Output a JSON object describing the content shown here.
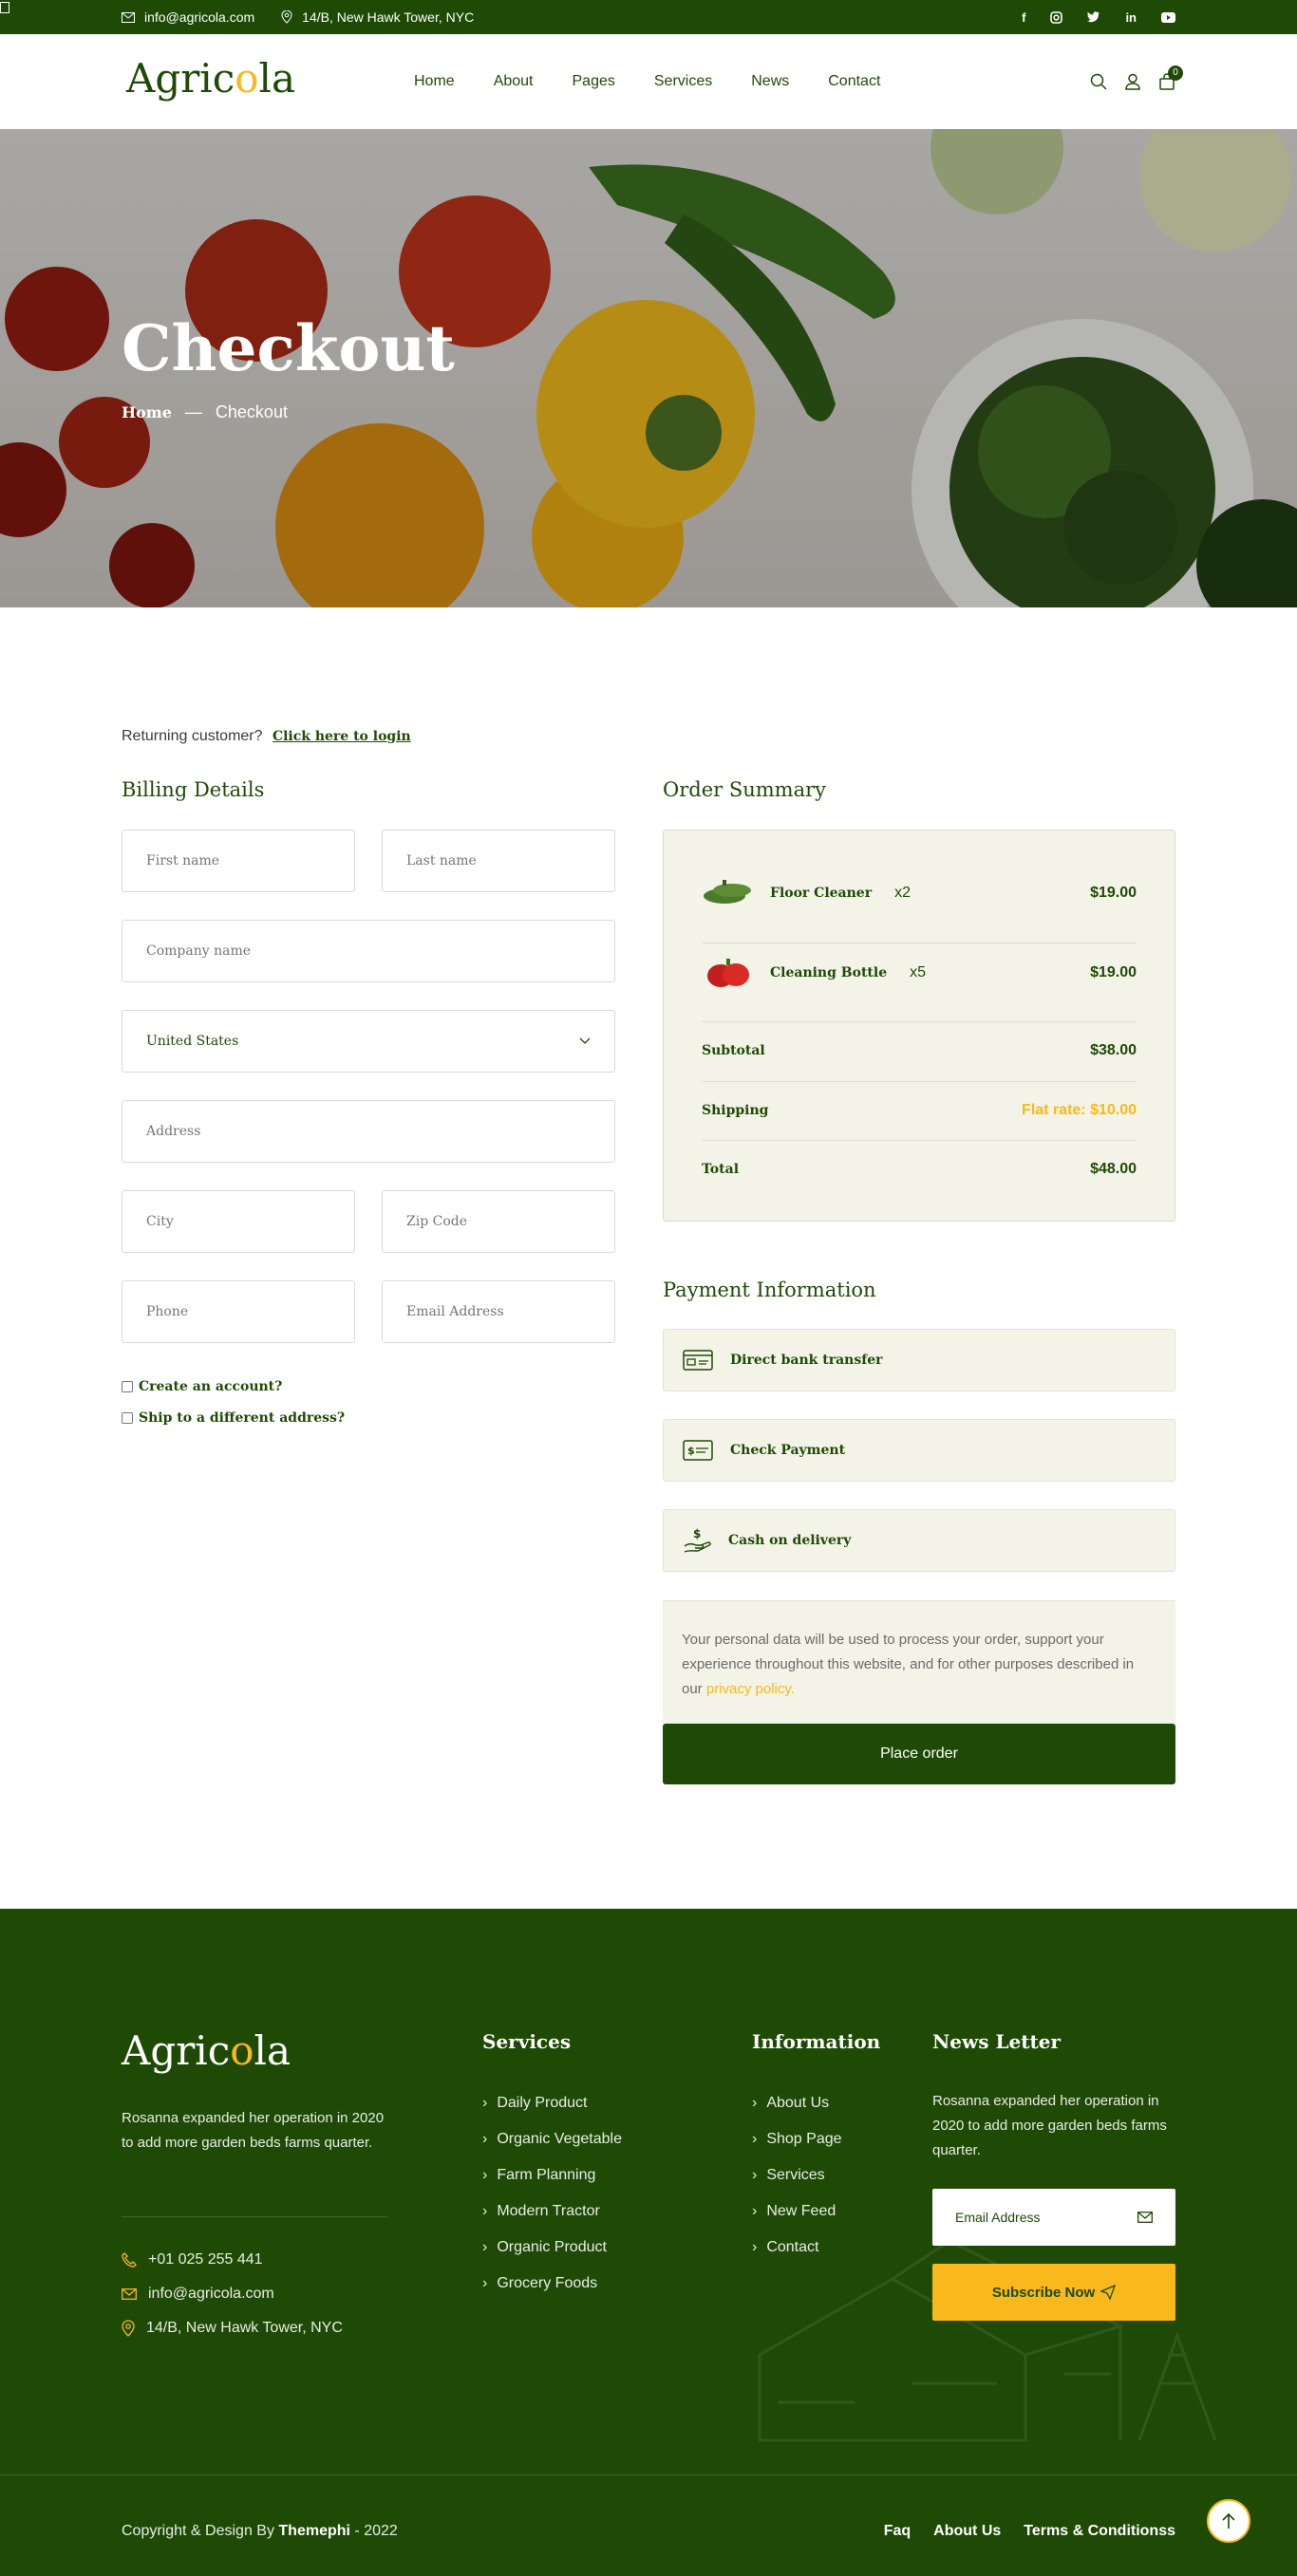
{
  "topbar": {
    "email": "info@agricola.com",
    "address": "14/B, New Hawk Tower, NYC",
    "social": [
      "f",
      "ig",
      "tw",
      "in",
      "yt"
    ]
  },
  "header": {
    "logo_pre": "Agric",
    "logo_o": "o",
    "logo_post": "la",
    "nav": [
      "Home",
      "About",
      "Pages",
      "Services",
      "News",
      "Contact"
    ],
    "cart_count": "0"
  },
  "hero": {
    "title": "Checkout",
    "breadcrumb_home": "Home",
    "breadcrumb_sep": "—",
    "breadcrumb_current": "Checkout"
  },
  "checkout": {
    "returning_text": "Returning customer?",
    "login_link": "Click here to login",
    "billing_title": "Billing Details",
    "placeholders": {
      "first_name": "First name",
      "last_name": "Last name",
      "company": "Company name",
      "address": "Address",
      "city": "City",
      "zip": "Zip Code",
      "phone": "Phone",
      "email": "Email Address"
    },
    "country": "United States",
    "create_account": "Create an account?",
    "ship_different": "Ship to a different address?"
  },
  "summary": {
    "title": "Order Summary",
    "items": [
      {
        "name": "Floor Cleaner",
        "qty": "x2",
        "price": "$19.00"
      },
      {
        "name": "Cleaning Bottle",
        "qty": "x5",
        "price": "$19.00"
      }
    ],
    "subtotal_label": "Subtotal",
    "subtotal": "$38.00",
    "shipping_label": "Shipping",
    "shipping": "Flat rate: $10.00",
    "total_label": "Total",
    "total": "$48.00"
  },
  "payment": {
    "title": "Payment Information",
    "methods": [
      "Direct bank transfer",
      "Check Payment",
      "Cash on delivery"
    ],
    "note": "Your personal data will be used to process your order, support your experience throughout this website, and for other purposes described in our ",
    "note_link": "privacy policy.",
    "place_order": "Place order"
  },
  "footer": {
    "logo_pre": "Agric",
    "logo_o": "o",
    "logo_post": "la",
    "description": "Rosanna expanded her operation in 2020 to add more garden beds farms quarter.",
    "phone": "+01 025 255 441",
    "email": "info@agricola.com",
    "address": "14/B, New Hawk Tower, NYC",
    "services_title": "Services",
    "services": [
      "Daily Product",
      "Organic Vegetable",
      "Farm Planning",
      "Modern Tractor",
      "Organic Product",
      "Grocery Foods"
    ],
    "info_title": "Information",
    "info": [
      "About Us",
      "Shop Page",
      "Services",
      "New Feed",
      "Contact"
    ],
    "newsletter_title": "News Letter",
    "newsletter_desc": "Rosanna expanded her operation in 2020 to add more garden beds farms quarter.",
    "newsletter_placeholder": "Email Address",
    "subscribe": "Subscribe Now",
    "copyright_pre": "Copyright & Design By ",
    "copyright_brand": "Themephi",
    "copyright_post": " - 2022",
    "bottom_links": [
      "Faq",
      "About Us",
      "Terms & Conditionss"
    ]
  },
  "colors": {
    "primary_green": "#1f4a06",
    "accent_yellow": "#f9b81c",
    "panel_bg": "#f3f3e7"
  }
}
